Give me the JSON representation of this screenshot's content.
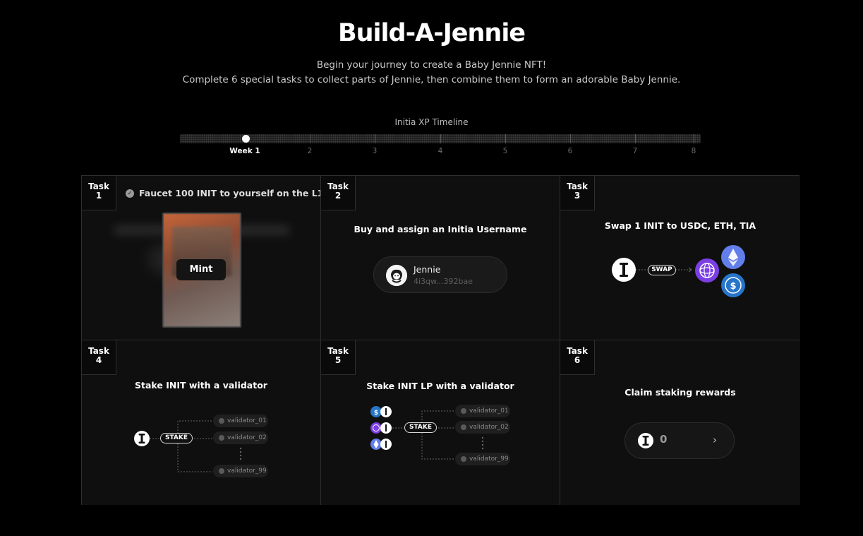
{
  "header": {
    "title": "Build-A-Jennie",
    "subtitle_line1": "Begin your journey to create a Baby Jennie NFT!",
    "subtitle_line2": "Complete 6 special tasks to collect parts of Jennie, then combine them to form an adorable Baby Jennie."
  },
  "timeline": {
    "label": "Initia XP Timeline",
    "weeks": [
      "Week 1",
      "2",
      "3",
      "4",
      "5",
      "6",
      "7",
      "8"
    ],
    "current_week": 1
  },
  "tasks": [
    {
      "badge_word": "Task",
      "number": "1",
      "title": "Faucet 100 INIT to yourself on the L1",
      "completed": true,
      "button": "Mint"
    },
    {
      "badge_word": "Task",
      "number": "2",
      "title": "Buy and assign an Initia Username",
      "username": "Jennie",
      "address": "4i3qw...392bae"
    },
    {
      "badge_word": "Task",
      "number": "3",
      "title": "Swap 1 INIT to USDC, ETH, TIA",
      "action": "SWAP"
    },
    {
      "badge_word": "Task",
      "number": "4",
      "title": "Stake INIT with a validator",
      "action": "STAKE",
      "validators": [
        "validator_01",
        "validator_02",
        "validator_99"
      ]
    },
    {
      "badge_word": "Task",
      "number": "5",
      "title": "Stake INIT LP with a validator",
      "action": "STAKE",
      "validators": [
        "validator_01",
        "validator_02",
        "validator_99"
      ]
    },
    {
      "badge_word": "Task",
      "number": "6",
      "title": "Claim staking rewards",
      "reward": "0"
    }
  ],
  "colors": {
    "background": "#000000",
    "panel": "#0f0f0f",
    "border": "#2e2e2e",
    "tia_purple": "#7b3fe4",
    "usdc_blue": "#2775ca",
    "eth_blue": "#627eea"
  }
}
